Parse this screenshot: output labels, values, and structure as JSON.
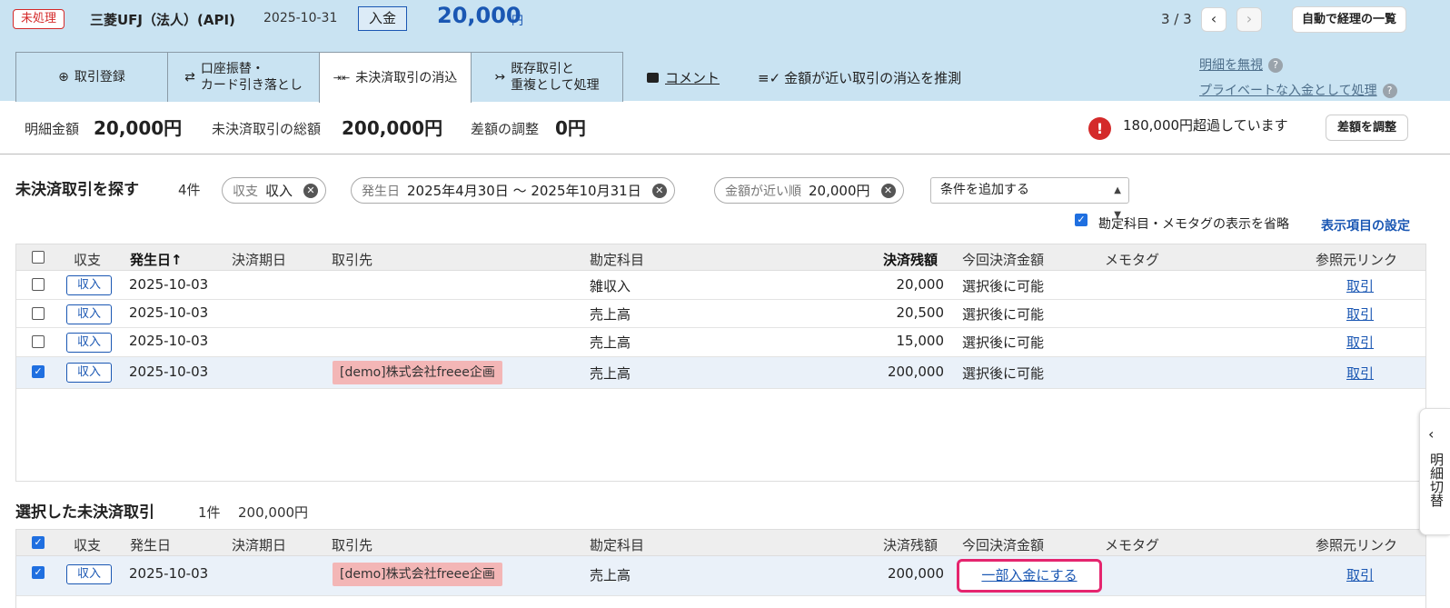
{
  "header": {
    "status": "未処理",
    "bank_name": "三菱UFJ（法人）(API)",
    "date": "2025-10-31",
    "type": "入金",
    "amount": "20,000",
    "amount_unit": "円",
    "pager": "3 / 3",
    "prev_icon": "‹",
    "next_icon": "›",
    "auto_button": "自動で経理の一覧"
  },
  "tabs": [
    {
      "icon": "⊕",
      "label": "取引登録",
      "active": false
    },
    {
      "icon": "⇄",
      "label": "口座振替・\nカード引き落とし",
      "active": false
    },
    {
      "icon": "⇥⇤",
      "label": "未決済取引の消込",
      "active": true
    },
    {
      "icon": "↣",
      "label": "既存取引と\n重複として処理",
      "active": false
    }
  ],
  "actions": {
    "comment": "コメント",
    "guess": "金額が近い取引の消込を推測",
    "ignore": "明細を無視",
    "private": "プライベートな入金として処理",
    "help": "?"
  },
  "summary": {
    "detail_label": "明細金額",
    "detail_value": "20,000円",
    "total_label": "未決済取引の総額",
    "total_value": "200,000円",
    "adjust_label": "差額の調整",
    "adjust_value": "0円",
    "warning": "180,000円超過しています",
    "adjust_button": "差額を調整"
  },
  "search": {
    "title": "未決済取引を探す",
    "count": "4件",
    "chips": [
      {
        "key": "収支",
        "value": "収入"
      },
      {
        "key": "発生日",
        "value": "2025年4月30日 〜 2025年10月31日"
      },
      {
        "key": "金額が近い順",
        "value": "20,000円"
      }
    ],
    "condition_select": "条件を追加する",
    "omit_label": "勘定科目・メモタグの表示を省略",
    "display_settings": "表示項目の設定"
  },
  "columns": {
    "kind": "収支",
    "date": "発生日",
    "due": "決済期日",
    "partner": "取引先",
    "account": "勘定科目",
    "balance": "決済残額",
    "this_amount": "今回決済金額",
    "memo": "メモタグ",
    "ref": "参照元リンク",
    "sort_arrow": "↑"
  },
  "results": [
    {
      "checked": false,
      "kind": "収入",
      "date": "2025-10-03",
      "partner": "",
      "account": "雑収入",
      "balance": "20,000",
      "this_amount": "選択後に可能",
      "ref": "取引"
    },
    {
      "checked": false,
      "kind": "収入",
      "date": "2025-10-03",
      "partner": "",
      "account": "売上高",
      "balance": "20,500",
      "this_amount": "選択後に可能",
      "ref": "取引"
    },
    {
      "checked": false,
      "kind": "収入",
      "date": "2025-10-03",
      "partner": "",
      "account": "売上高",
      "balance": "15,000",
      "this_amount": "選択後に可能",
      "ref": "取引"
    },
    {
      "checked": true,
      "kind": "収入",
      "date": "2025-10-03",
      "partner": "[demo]株式会社freee企画",
      "account": "売上高",
      "balance": "200,000",
      "this_amount": "選択後に可能",
      "ref": "取引"
    }
  ],
  "selected": {
    "title": "選択した未決済取引",
    "count": "1件",
    "total": "200,000円",
    "rows": [
      {
        "kind": "収入",
        "date": "2025-10-03",
        "partner": "[demo]株式会社freee企画",
        "account": "売上高",
        "balance": "200,000",
        "action": "一部入金にする",
        "ref": "取引"
      }
    ]
  },
  "side": {
    "label": "明細切替",
    "icon": "‹"
  },
  "colors": {
    "header_bg": "#c9e3f2",
    "accent": "#1a57b3",
    "alert": "#d42a2a",
    "highlight": "#e5256e",
    "partner_tag": "#f3b6b6"
  }
}
